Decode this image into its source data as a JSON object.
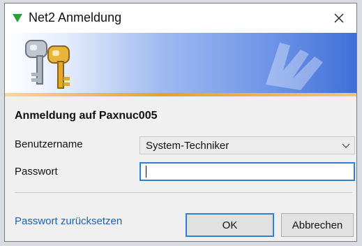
{
  "window": {
    "title": "Net2 Anmeldung"
  },
  "form": {
    "heading": "Anmeldung auf Paxnuc005",
    "username_label": "Benutzername",
    "username_value": "System-Techniker",
    "password_label": "Passwort",
    "password_value": ""
  },
  "footer": {
    "reset_link": "Passwort zurücksetzen",
    "ok_label": "OK",
    "cancel_label": "Abbrechen"
  },
  "icons": [
    "net2-app-icon",
    "close-icon",
    "keys-icon",
    "chevron-down-icon"
  ],
  "colors": {
    "accent": "#2f7fd4",
    "link": "#1b63b6",
    "banner_orange": "#f19b2b"
  }
}
